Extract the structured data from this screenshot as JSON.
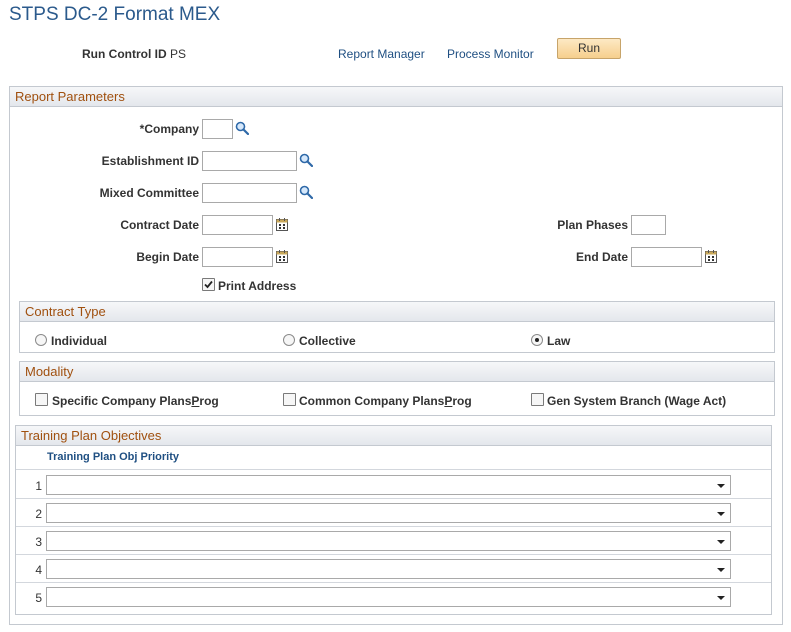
{
  "page": {
    "title": "STPS DC-2 Format MEX"
  },
  "run_control": {
    "label": "Run Control ID",
    "value": "PS",
    "report_manager": "Report Manager",
    "process_monitor": "Process Monitor",
    "run_button": "Run"
  },
  "report_parameters": {
    "heading": "Report Parameters",
    "company": {
      "label": "*Company",
      "value": ""
    },
    "establishment_id": {
      "label": "Establishment ID",
      "value": ""
    },
    "mixed_committee": {
      "label": "Mixed Committee",
      "value": ""
    },
    "contract_date": {
      "label": "Contract Date",
      "value": ""
    },
    "plan_phases": {
      "label": "Plan Phases",
      "value": ""
    },
    "begin_date": {
      "label": "Begin Date",
      "value": ""
    },
    "end_date": {
      "label": "End Date",
      "value": ""
    },
    "print_address": {
      "label": "Print Address",
      "checked": true
    }
  },
  "contract_type": {
    "heading": "Contract Type",
    "options": [
      {
        "label": "Individual",
        "selected": false
      },
      {
        "label": "Collective",
        "selected": false
      },
      {
        "label": "Law",
        "selected": true
      }
    ]
  },
  "modality": {
    "heading": "Modality",
    "options": [
      {
        "label_pre": "Specific Company Plans",
        "label_u": "P",
        "label_post": "rog",
        "checked": false
      },
      {
        "label_pre": "Common Company Plans",
        "label_u": "P",
        "label_post": "rog",
        "checked": false
      },
      {
        "label_pre": "Gen System Branch (Wage Act)",
        "label_u": "",
        "label_post": "",
        "checked": false
      }
    ]
  },
  "training": {
    "heading": "Training Plan Objectives",
    "column": "Training Plan Obj Priority",
    "rows": [
      {
        "num": "1",
        "value": ""
      },
      {
        "num": "2",
        "value": ""
      },
      {
        "num": "3",
        "value": ""
      },
      {
        "num": "4",
        "value": ""
      },
      {
        "num": "5",
        "value": ""
      }
    ]
  },
  "icons": {
    "lookup": "magnifier-icon",
    "calendar": "calendar-icon"
  }
}
